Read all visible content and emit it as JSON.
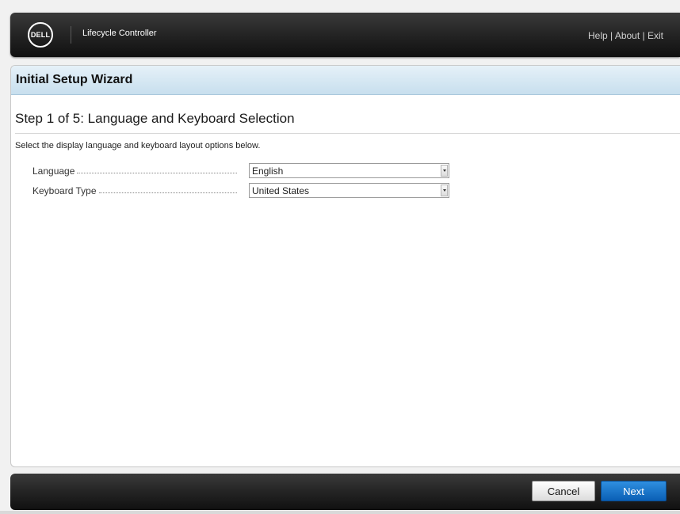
{
  "header": {
    "logo_text": "DELL",
    "app_title": "Lifecycle Controller",
    "links": {
      "help": "Help",
      "about": "About",
      "exit": "Exit",
      "separator": "|"
    }
  },
  "wizard": {
    "title": "Initial Setup Wizard",
    "step_title": "Step 1 of 5: Language and Keyboard Selection",
    "instructions": "Select the display language and keyboard layout options below."
  },
  "fields": {
    "language": {
      "label": "Language",
      "value": "English"
    },
    "keyboard": {
      "label": "Keyboard Type",
      "value": "United States"
    }
  },
  "footer": {
    "cancel_label": "Cancel",
    "next_label": "Next"
  },
  "colors": {
    "header_bg": "#1e1e1e",
    "wizard_header_bg": "#d3e6f2",
    "next_button": "#0a5fb5"
  }
}
